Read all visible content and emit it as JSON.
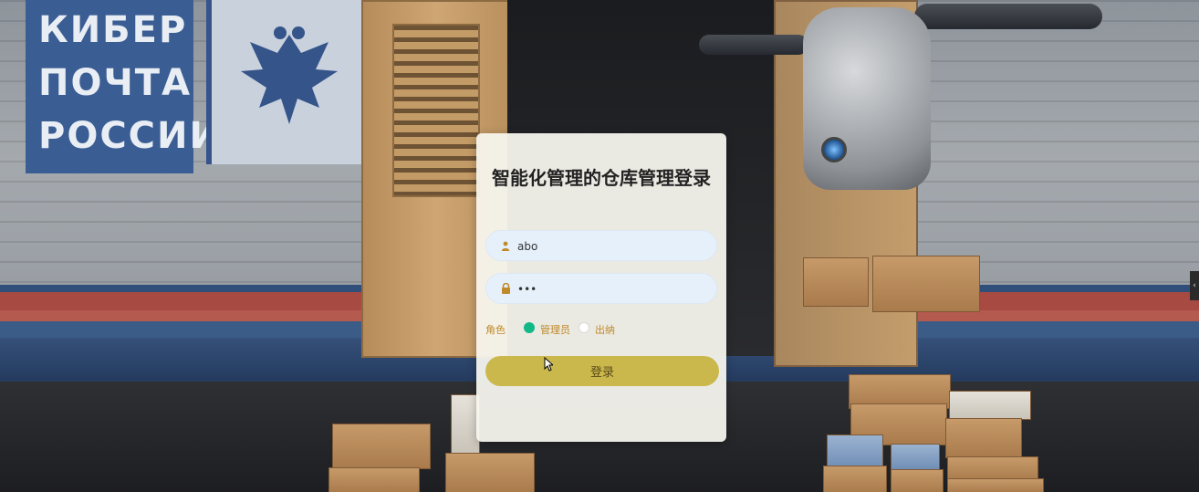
{
  "background": {
    "logo_lines": [
      "КИБЕР",
      "ПОЧТА",
      "РОССИИ"
    ]
  },
  "login": {
    "title": "智能化管理的仓库管理登录",
    "username": {
      "value": "abo",
      "icon": "user-icon"
    },
    "password": {
      "value": "•••",
      "icon": "lock-icon"
    },
    "role": {
      "label": "角色",
      "options": [
        {
          "label": "管理员",
          "selected": true
        },
        {
          "label": "出纳",
          "selected": false
        }
      ]
    },
    "submit_label": "登录"
  },
  "colors": {
    "button": "#cbb84c",
    "radio_selected": "#12b886",
    "input_bg": "#e6f0fb",
    "role_text": "#c08a2a"
  }
}
